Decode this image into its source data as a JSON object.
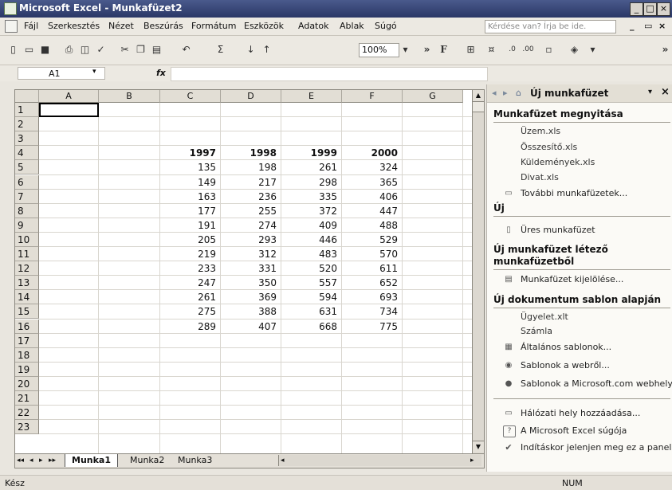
{
  "window": {
    "title": "Microsoft Excel - Munkafüzet2",
    "minimize": "_",
    "maximize": "□",
    "close": "×"
  },
  "menu": {
    "items": [
      "Fájl",
      "Szerkesztés",
      "Nézet",
      "Beszúrás",
      "Formátum",
      "Eszközök",
      "Adatok",
      "Ablak",
      "Súgó"
    ],
    "help_placeholder": "Kérdése van? Írja be ide.",
    "doc_minimize": "_",
    "doc_restore": "▭",
    "doc_close": "×"
  },
  "toolbar": {
    "zoom": "100%",
    "sum": "Σ",
    "bold_label": "F",
    "more": "»"
  },
  "formula_bar": {
    "name_box": "A1",
    "fx": "fx",
    "content": ""
  },
  "grid": {
    "columns": [
      "A",
      "B",
      "C",
      "D",
      "E",
      "F",
      "G"
    ],
    "rows": [
      "1",
      "2",
      "3",
      "4",
      "5",
      "6",
      "7",
      "8",
      "9",
      "10",
      "11",
      "12",
      "13",
      "14",
      "15",
      "16",
      "17",
      "18",
      "19",
      "20",
      "21",
      "22",
      "23"
    ],
    "headers": [
      "1997",
      "1998",
      "1999",
      "2000"
    ],
    "data": [
      [
        "135",
        "198",
        "261",
        "324"
      ],
      [
        "149",
        "217",
        "298",
        "365"
      ],
      [
        "163",
        "236",
        "335",
        "406"
      ],
      [
        "177",
        "255",
        "372",
        "447"
      ],
      [
        "191",
        "274",
        "409",
        "488"
      ],
      [
        "205",
        "293",
        "446",
        "529"
      ],
      [
        "219",
        "312",
        "483",
        "570"
      ],
      [
        "233",
        "331",
        "520",
        "611"
      ],
      [
        "247",
        "350",
        "557",
        "652"
      ],
      [
        "261",
        "369",
        "594",
        "693"
      ],
      [
        "275",
        "388",
        "631",
        "734"
      ],
      [
        "289",
        "407",
        "668",
        "775"
      ]
    ]
  },
  "sheets": {
    "tabs": [
      "Munka1",
      "Munka2",
      "Munka3"
    ],
    "active": "Munka1",
    "nav": [
      "◂◂",
      "◂",
      "▸",
      "▸▸"
    ]
  },
  "status": {
    "left": "Kész",
    "num": "NUM"
  },
  "task_pane": {
    "title": "Új munkafüzet",
    "open_heading": "Munkafüzet megnyitása",
    "recent_files": [
      "Üzem.xls",
      "Összesítő.xls",
      "Küldemények.xls",
      "Divat.xls"
    ],
    "more_workbooks": "További munkafüzetek...",
    "new_heading": "Új",
    "blank_workbook": "Üres munkafüzet",
    "from_existing_heading_1": "Új munkafüzet létező",
    "from_existing_heading_2": "munkafüzetből",
    "choose_workbook": "Munkafüzet kijelölése...",
    "template_heading": "Új dokumentum sablon alapján",
    "templates": [
      "Ügyelet.xlt",
      "Számla"
    ],
    "general_templates": "Általános sablonok...",
    "web_templates": "Sablonok a webről...",
    "ms_templates": "Sablonok a Microsoft.com webhelyen",
    "add_network": "Hálózati hely hozzáadása...",
    "excel_help": "A Microsoft Excel súgója",
    "show_on_startup": "Indításkor jelenjen meg ez a panel"
  }
}
